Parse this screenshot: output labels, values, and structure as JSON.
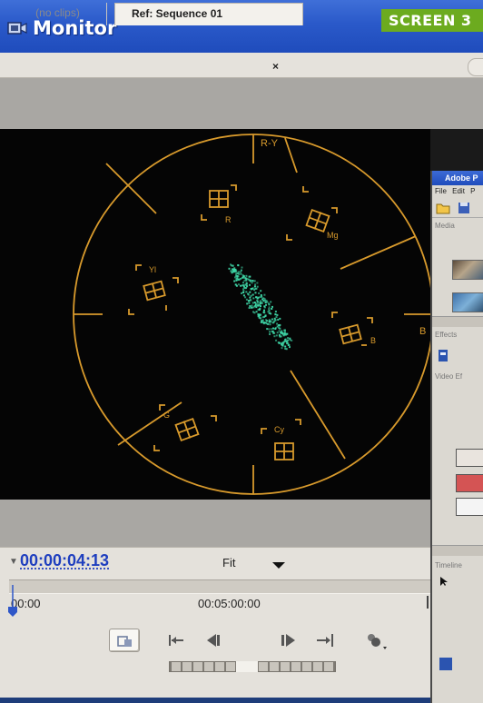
{
  "window": {
    "title": "Monitor",
    "badge": "SCREEN 3"
  },
  "tabs": [
    {
      "label": "(no clips)",
      "active": false
    },
    {
      "label": "Ref: Sequence 01",
      "active": true,
      "close_glyph": "×"
    }
  ],
  "vectorscope": {
    "labels": {
      "top": "R-Y",
      "right": "B",
      "targets": [
        "R",
        "Mg",
        "B",
        "Cy",
        "G",
        "Yl"
      ]
    },
    "colors": {
      "graticule": "#d89a2c",
      "trace": "#3fd8a8",
      "background": "#050505"
    }
  },
  "overlay_window": {
    "title": "Adobe P",
    "menu": [
      "File",
      "Edit",
      "P"
    ],
    "panels": [
      "Media",
      "Effects",
      "Timeline"
    ],
    "effects_item": "Video Ef"
  },
  "controls": {
    "timecode": "00:00:04:13",
    "zoom_label": "Fit",
    "ruler_start": "00:00",
    "ruler_mid": "00:05:00:00",
    "icons": [
      "safe-margins-icon",
      "step-back-to-in-icon",
      "step-back-icon",
      "step-forward-icon",
      "step-forward-to-out-icon",
      "output-icon"
    ]
  }
}
